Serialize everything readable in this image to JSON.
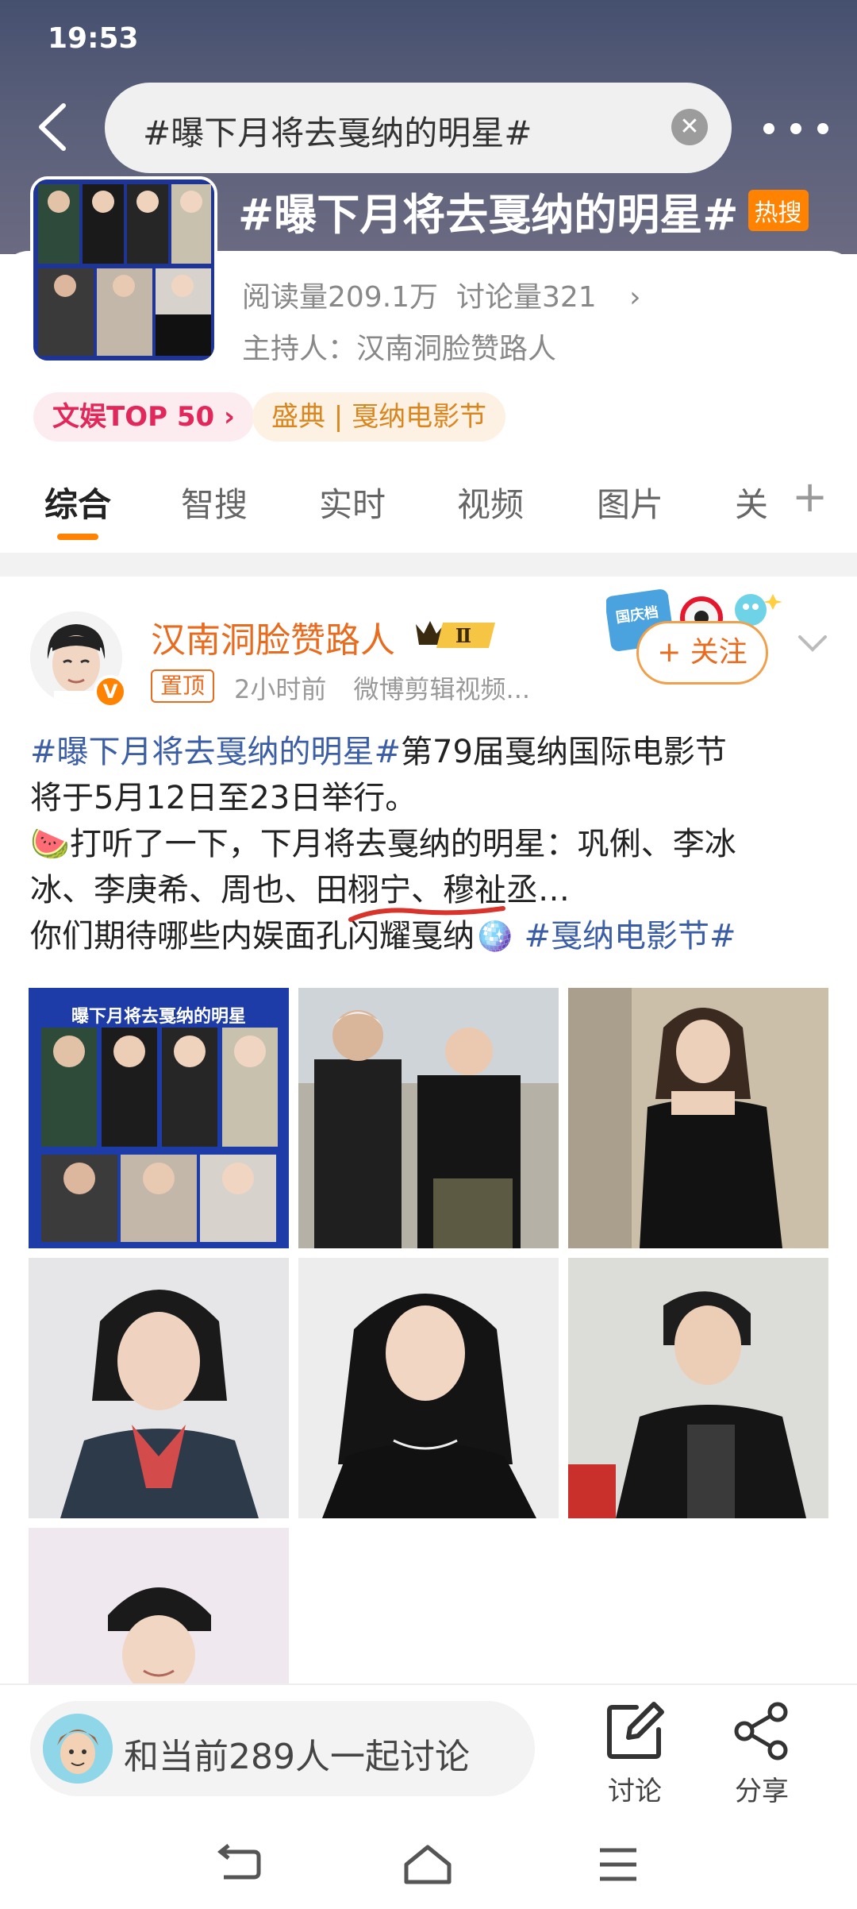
{
  "status_bar": {
    "time": "19:53"
  },
  "search": {
    "query": "#曝下月将去戛纳的明星#"
  },
  "topic": {
    "title": "#曝下月将去戛纳的明星#",
    "hot_label": "热搜",
    "stats": "阅读量209.1万  讨论量321",
    "chevron": "›",
    "host": "主持人：汉南洞脸赞路人",
    "cover_poster_text": "曝下月将去戛纳的明星"
  },
  "tags": [
    {
      "label": "文娱TOP 50 ›"
    },
    {
      "label": "盛典 | 戛纳电影节"
    }
  ],
  "tabs": [
    {
      "label": "综合",
      "active": true
    },
    {
      "label": "智搜"
    },
    {
      "label": "实时"
    },
    {
      "label": "视频"
    },
    {
      "label": "图片"
    },
    {
      "label": "关"
    }
  ],
  "tab_plus": "+",
  "post": {
    "author": "汉南洞脸赞路人",
    "level_badge": "Ⅱ",
    "pinned_label": "置顶",
    "time": "2小时前",
    "source": "微博剪辑视频...",
    "follow_label": "+ 关注",
    "festival_badge_text": "国庆档",
    "text_lines": [
      {
        "hashtag": "#曝下月将去戛纳的明星#",
        "rest": "第79届戛纳国际电影节"
      },
      {
        "rest": "将于5月12日至23日举行。"
      },
      {
        "emoji": "🍉",
        "rest": "打听了一下，下月将去戛纳的明星：巩俐、李冰"
      },
      {
        "rest": "冰、李庚希、周也、田栩宁、穆祉丞…"
      },
      {
        "rest": "你们期待哪些内娱面孔闪耀戛纳",
        "emoji2": "🪩",
        "hashtag2": "#戛纳电影节#"
      }
    ],
    "image_poster_text": "曝下月将去戛纳的明星"
  },
  "bottom": {
    "discuss_text": "和当前289人一起讨论",
    "comment_label": "讨论",
    "share_label": "分享"
  },
  "colors": {
    "accent_orange": "#ff8200",
    "author_orange": "#e86b1e",
    "hashtag_blue": "#3b5ea6",
    "top_tag_red": "#e2285a"
  }
}
